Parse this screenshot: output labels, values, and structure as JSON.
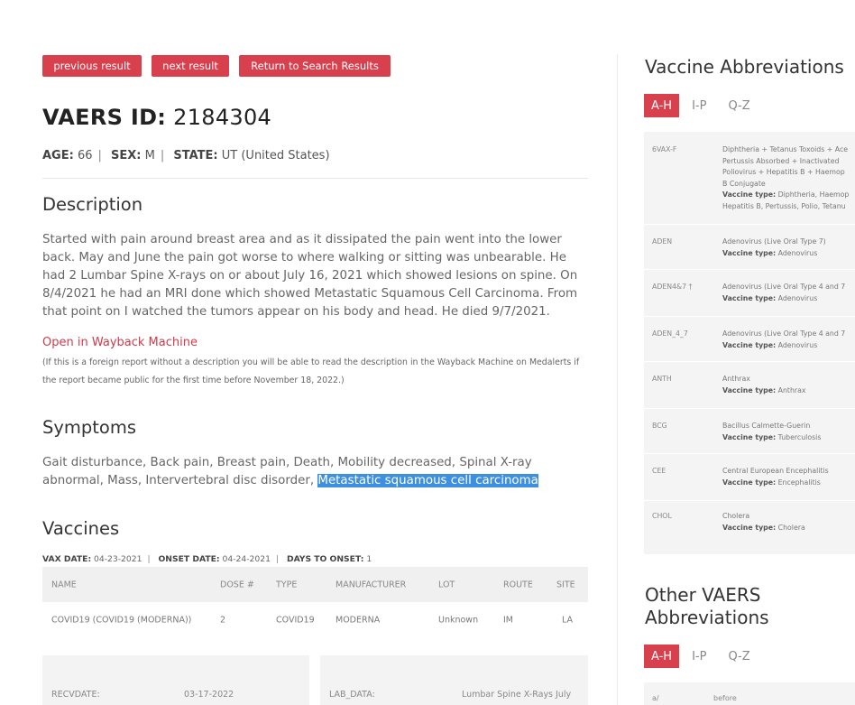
{
  "nav": {
    "previous": "previous result",
    "next": "next result",
    "return": "Return to Search Results"
  },
  "report": {
    "id_label": "VAERS ID:",
    "id_value": "2184304",
    "age_label": "AGE:",
    "age": "66",
    "sex_label": "SEX:",
    "sex": "M",
    "state_label": "STATE:",
    "state": "UT (United States)"
  },
  "description": {
    "heading": "Description",
    "text": "Started with pain around breast area and as it dissipated the pain went into the lower back. May and June the pain got worse to where walking or sitting was unbearable. He had 2 Lumbar Spine X-rays on or about July 16, 2021 which showed lesions on spine. On 8/4/2021 he had an MRI done which showed Metastatic Squamous Cell Carcinoma. From that point on I watched the tumors appear on his body and head. He died 9/7/2021.",
    "wayback_link": "Open in Wayback Machine",
    "wayback_note": "(If this is a foreign report without a description you will be able to read the description in the Wayback Machine on Medalerts if the report became public for the first time before November 18, 2022.)"
  },
  "symptoms": {
    "heading": "Symptoms",
    "text": "Gait disturbance, Back pain, Breast pain, Death, Mobility decreased, Spinal X-ray abnormal, Mass, Intervertebral disc disorder,",
    "highlighted": "Metastatic squamous cell carcinoma"
  },
  "vaccines": {
    "heading": "Vaccines",
    "vax_date_label": "VAX DATE:",
    "vax_date": "04-23-2021",
    "onset_date_label": "ONSET DATE:",
    "onset_date": "04-24-2021",
    "days_label": "DAYS TO ONSET:",
    "days": "1",
    "columns": [
      "NAME",
      "DOSE #",
      "TYPE",
      "MANUFACTURER",
      "LOT",
      "ROUTE",
      "SITE"
    ],
    "rows": [
      [
        "COVID19 (COVID19 (MODERNA))",
        "2",
        "COVID19",
        "MODERNA",
        "Unknown",
        "IM",
        "LA"
      ]
    ]
  },
  "details": {
    "recvdate_label": "RECVDATE:",
    "recvdate": "03-17-2022",
    "lab_label": "LAB_DATA:",
    "lab_value": "Lumbar Spine X-Rays July"
  },
  "sidebar": {
    "vaccine_title": "Vaccine Abbreviations",
    "tabs": [
      "A-H",
      "I-P",
      "Q-Z"
    ],
    "vaccine_rows": [
      {
        "abbr": "6VAX-F",
        "lines": [
          "Diphtheria + Tetanus Toxoids + Ace",
          "Pertussis Absorbed + Inactivated",
          "Poliovirus + Hepatitis B + Haemop",
          "B Conjugate"
        ],
        "type_label": "Vaccine type:",
        "type": "Diphtheria, Haemop",
        "type2": "Hepatitis B, Pertussis, Polio, Tetanu"
      },
      {
        "abbr": "ADEN",
        "lines": [
          "Adenovirus (Live Oral Type 7)"
        ],
        "type_label": "Vaccine type:",
        "type": "Adenovirus"
      },
      {
        "abbr": "ADEN4&7 †",
        "lines": [
          "Adenovirus (Live Oral Type 4 and 7"
        ],
        "type_label": "Vaccine type:",
        "type": "Adenovirus"
      },
      {
        "abbr": "ADEN_4_7",
        "lines": [
          "Adenovirus (Live Oral Type 4 and 7"
        ],
        "type_label": "Vaccine type:",
        "type": "Adenovirus"
      },
      {
        "abbr": "ANTH",
        "lines": [
          "Anthrax"
        ],
        "type_label": "Vaccine type:",
        "type": "Anthrax"
      },
      {
        "abbr": "BCG",
        "lines": [
          "Bacillus Calmette-Guerin"
        ],
        "type_label": "Vaccine type:",
        "type": "Tuberculosis"
      },
      {
        "abbr": "CEE",
        "lines": [
          "Central European Encephalitis"
        ],
        "type_label": "Vaccine type:",
        "type": "Encephalitis"
      },
      {
        "abbr": "CHOL",
        "lines": [
          "Cholera"
        ],
        "type_label": "Vaccine type:",
        "type": "Cholera"
      }
    ],
    "other_title_1": "Other VAERS",
    "other_title_2": "Abbreviations",
    "other_tabs": [
      "A-H",
      "I-P",
      "Q-Z"
    ],
    "other_rows": [
      {
        "abbr": "a/",
        "desc": "before"
      }
    ]
  },
  "colors": {
    "accent": "#d9404e",
    "highlight": "#3d8fe0"
  }
}
